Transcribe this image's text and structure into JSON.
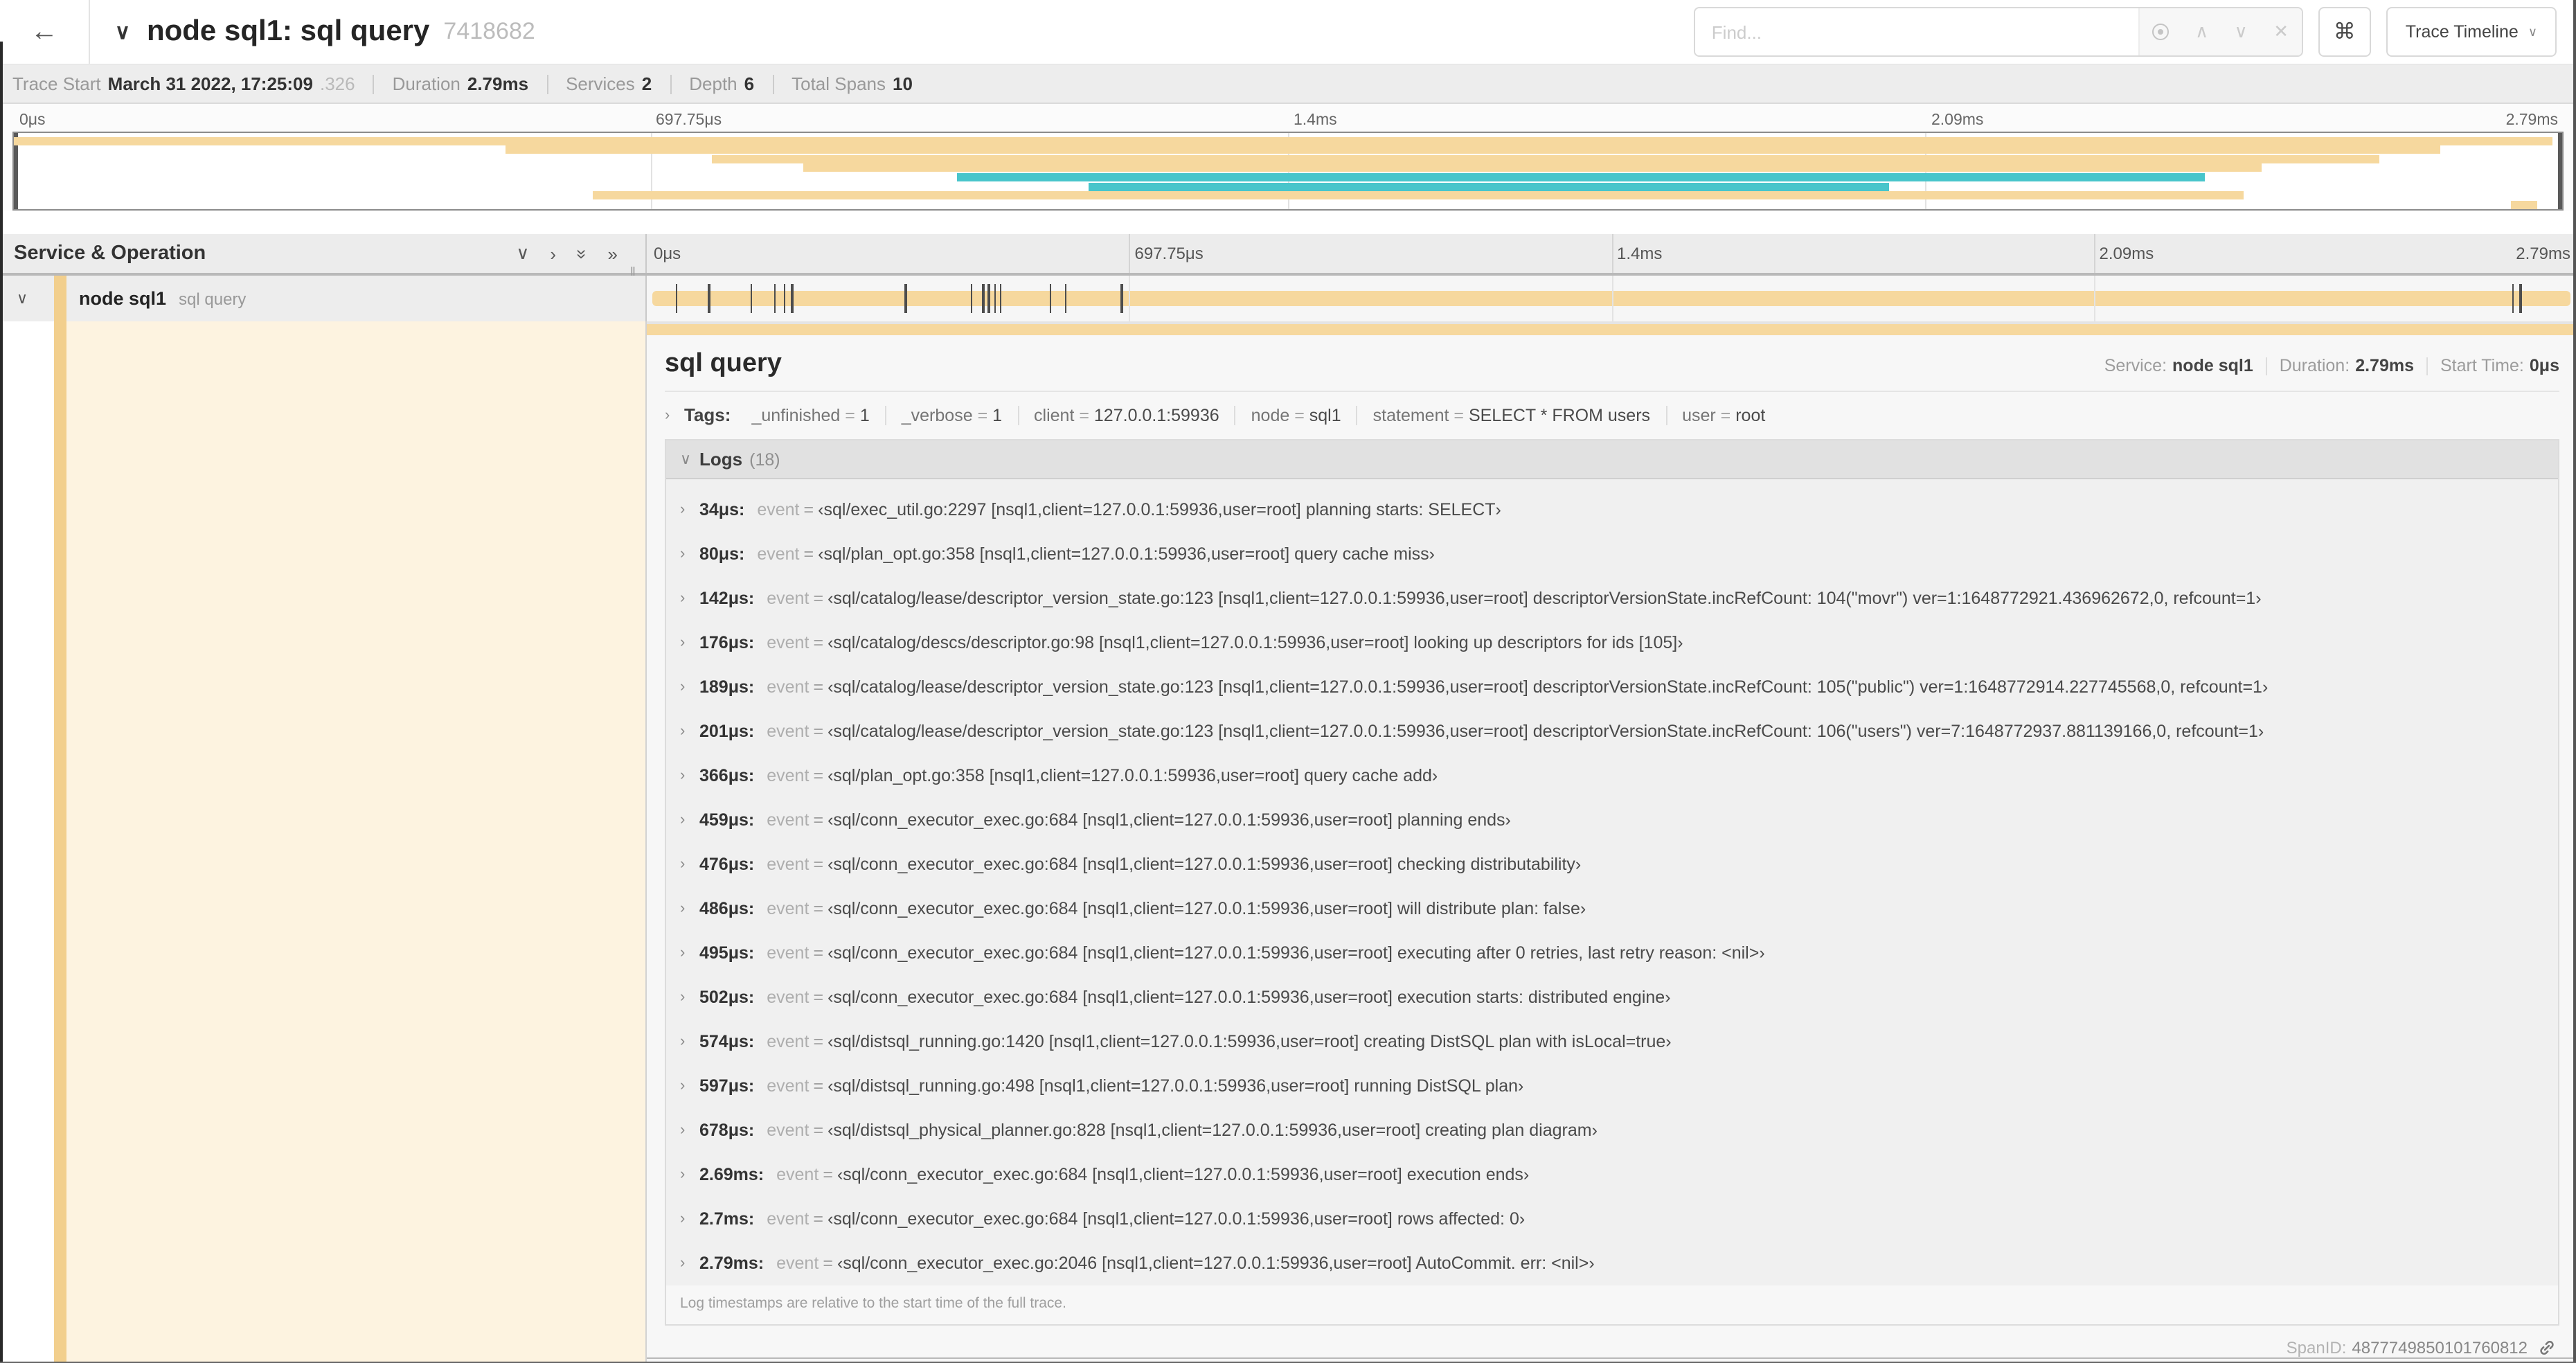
{
  "header": {
    "title": "node sql1: sql query",
    "trace_id": "7418682",
    "find_placeholder": "Find...",
    "shortcut_key": "⌘",
    "view_selector": "Trace Timeline"
  },
  "icons": {
    "back": "←",
    "chevron_down": "∨",
    "chevron_right": "›",
    "double_chevron": "»",
    "up": "∧",
    "down": "∨",
    "clear": "✕",
    "grip": "‖",
    "dropdown": "∨"
  },
  "trace_meta": [
    {
      "label": "Trace Start",
      "value": "March 31 2022, 17:25:09",
      "suffix": ".326"
    },
    {
      "label": "Duration",
      "value": "2.79ms"
    },
    {
      "label": "Services",
      "value": "2"
    },
    {
      "label": "Depth",
      "value": "6"
    },
    {
      "label": "Total Spans",
      "value": "10"
    }
  ],
  "ruler": {
    "ticks": [
      "0μs",
      "697.75μs",
      "1.4ms",
      "2.09ms",
      "2.79ms"
    ],
    "tick_pcts": [
      0,
      25,
      50,
      75,
      100
    ],
    "grid_pcts": [
      25,
      50,
      75
    ]
  },
  "colors": {
    "tan": "#f6d89e",
    "tan_dark": "#f2cf8d",
    "teal": "#48c5cb",
    "cream": "#fdf3e0"
  },
  "minimap": {
    "bars": [
      {
        "row": 0,
        "color": "tan",
        "start": 0,
        "end": 99.6
      },
      {
        "row": 1,
        "color": "tan",
        "start": 19.3,
        "end": 95.2
      },
      {
        "row": 2,
        "color": "tan",
        "start": 27.4,
        "end": 92.8
      },
      {
        "row": 3,
        "color": "tan",
        "start": 31.0,
        "end": 88.2
      },
      {
        "row": 4,
        "color": "teal",
        "start": 37.0,
        "end": 86.0
      },
      {
        "row": 5,
        "color": "teal",
        "start": 42.2,
        "end": 73.6
      },
      {
        "row": 6,
        "color": "tan",
        "start": 22.7,
        "end": 87.5
      },
      {
        "row": 7,
        "color": "tan",
        "start": 98.0,
        "end": 99.0
      }
    ]
  },
  "left_panel": {
    "title": "Service & Operation",
    "row": {
      "service": "node sql1",
      "operation": "sql query"
    }
  },
  "timeline": {
    "log_marker_pcts": [
      1.2,
      2.9,
      5.1,
      6.3,
      6.8,
      7.2,
      13.1,
      16.5,
      17.1,
      17.4,
      17.7,
      18.0,
      20.6,
      21.4,
      24.3,
      96.4,
      96.8
    ]
  },
  "span_detail": {
    "title": "sql query",
    "service_label": "Service:",
    "service": "node sql1",
    "duration_label": "Duration:",
    "duration": "2.79ms",
    "start_label": "Start Time:",
    "start": "0μs",
    "tags_label": "Tags:",
    "tags": [
      {
        "key": "_unfinished",
        "value": "1"
      },
      {
        "key": "_verbose",
        "value": "1"
      },
      {
        "key": "client",
        "value": "127.0.0.1:59936"
      },
      {
        "key": "node",
        "value": "sql1"
      },
      {
        "key": "statement",
        "value": "SELECT * FROM users"
      },
      {
        "key": "user",
        "value": "root"
      }
    ],
    "logs_label": "Logs",
    "logs_count": "(18)",
    "logs": [
      {
        "time": "34μs:",
        "field": "event",
        "value": "‹sql/exec_util.go:2297 [nsql1,client=127.0.0.1:59936,user=root] planning starts: SELECT›"
      },
      {
        "time": "80μs:",
        "field": "event",
        "value": "‹sql/plan_opt.go:358 [nsql1,client=127.0.0.1:59936,user=root] query cache miss›"
      },
      {
        "time": "142μs:",
        "field": "event",
        "value": "‹sql/catalog/lease/descriptor_version_state.go:123 [nsql1,client=127.0.0.1:59936,user=root] descriptorVersionState.incRefCount: 104(\"movr\") ver=1:1648772921.436962672,0, refcount=1›"
      },
      {
        "time": "176μs:",
        "field": "event",
        "value": "‹sql/catalog/descs/descriptor.go:98 [nsql1,client=127.0.0.1:59936,user=root] looking up descriptors for ids [105]›"
      },
      {
        "time": "189μs:",
        "field": "event",
        "value": "‹sql/catalog/lease/descriptor_version_state.go:123 [nsql1,client=127.0.0.1:59936,user=root] descriptorVersionState.incRefCount: 105(\"public\") ver=1:1648772914.227745568,0, refcount=1›"
      },
      {
        "time": "201μs:",
        "field": "event",
        "value": "‹sql/catalog/lease/descriptor_version_state.go:123 [nsql1,client=127.0.0.1:59936,user=root] descriptorVersionState.incRefCount: 106(\"users\") ver=7:1648772937.881139166,0, refcount=1›"
      },
      {
        "time": "366μs:",
        "field": "event",
        "value": "‹sql/plan_opt.go:358 [nsql1,client=127.0.0.1:59936,user=root] query cache add›"
      },
      {
        "time": "459μs:",
        "field": "event",
        "value": "‹sql/conn_executor_exec.go:684 [nsql1,client=127.0.0.1:59936,user=root] planning ends›"
      },
      {
        "time": "476μs:",
        "field": "event",
        "value": "‹sql/conn_executor_exec.go:684 [nsql1,client=127.0.0.1:59936,user=root] checking distributability›"
      },
      {
        "time": "486μs:",
        "field": "event",
        "value": "‹sql/conn_executor_exec.go:684 [nsql1,client=127.0.0.1:59936,user=root] will distribute plan: false›"
      },
      {
        "time": "495μs:",
        "field": "event",
        "value": "‹sql/conn_executor_exec.go:684 [nsql1,client=127.0.0.1:59936,user=root] executing after 0 retries, last retry reason: <nil>›"
      },
      {
        "time": "502μs:",
        "field": "event",
        "value": "‹sql/conn_executor_exec.go:684 [nsql1,client=127.0.0.1:59936,user=root] execution starts: distributed engine›"
      },
      {
        "time": "574μs:",
        "field": "event",
        "value": "‹sql/distsql_running.go:1420 [nsql1,client=127.0.0.1:59936,user=root] creating DistSQL plan with isLocal=true›"
      },
      {
        "time": "597μs:",
        "field": "event",
        "value": "‹sql/distsql_running.go:498 [nsql1,client=127.0.0.1:59936,user=root] running DistSQL plan›"
      },
      {
        "time": "678μs:",
        "field": "event",
        "value": "‹sql/distsql_physical_planner.go:828 [nsql1,client=127.0.0.1:59936,user=root] creating plan diagram›"
      },
      {
        "time": "2.69ms:",
        "field": "event",
        "value": "‹sql/conn_executor_exec.go:684 [nsql1,client=127.0.0.1:59936,user=root] execution ends›"
      },
      {
        "time": "2.7ms:",
        "field": "event",
        "value": "‹sql/conn_executor_exec.go:684 [nsql1,client=127.0.0.1:59936,user=root] rows affected: 0›"
      },
      {
        "time": "2.79ms:",
        "field": "event",
        "value": "‹sql/conn_executor_exec.go:2046 [nsql1,client=127.0.0.1:59936,user=root] AutoCommit. err: <nil>›"
      }
    ],
    "footnote": "Log timestamps are relative to the start time of the full trace.",
    "span_id_label": "SpanID:",
    "span_id": "4877749850101760812"
  }
}
